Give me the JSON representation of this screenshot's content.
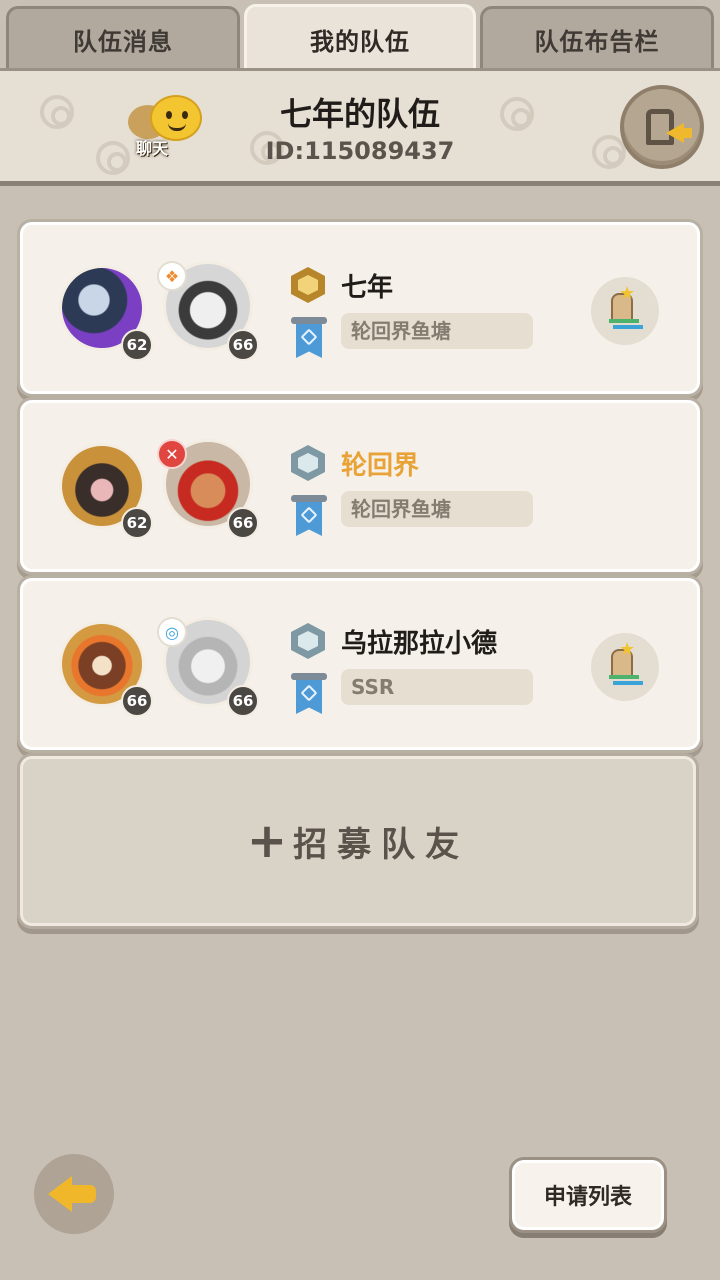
{
  "tabs": [
    {
      "label": "队伍消息",
      "active": false
    },
    {
      "label": "我的队伍",
      "active": true
    },
    {
      "label": "队伍布告栏",
      "active": false
    }
  ],
  "header": {
    "team_name": "七年的队伍",
    "team_id": "ID:115089437",
    "chat_label": "聊天",
    "chat_icon": "chat-bubble-icon",
    "exit_icon": "exit-team-icon"
  },
  "members": [
    {
      "pet_level": "62",
      "hero_level": "66",
      "name": "七年",
      "name_color": "#1f1c19",
      "rank_color": "#d4a63a",
      "guild": "轮回界鱼塘",
      "element_color": "#f08a2c",
      "has_swap": true
    },
    {
      "pet_level": "62",
      "hero_level": "66",
      "name": "轮回界",
      "name_color": "#e8a236",
      "rank_color": "#8fa9b4",
      "guild": "轮回界鱼塘",
      "element_color": "#e0463f",
      "has_swap": false
    },
    {
      "pet_level": "66",
      "hero_level": "66",
      "name": "乌拉那拉小德",
      "name_color": "#1f1c19",
      "rank_color": "#8fa9b4",
      "guild": "SSR",
      "element_color": "#3aa3d8",
      "has_swap": true
    }
  ],
  "recruit": {
    "plus": "+",
    "label": "招募队友"
  },
  "footer": {
    "back_icon": "back-arrow-icon",
    "apply_label": "申请列表"
  }
}
